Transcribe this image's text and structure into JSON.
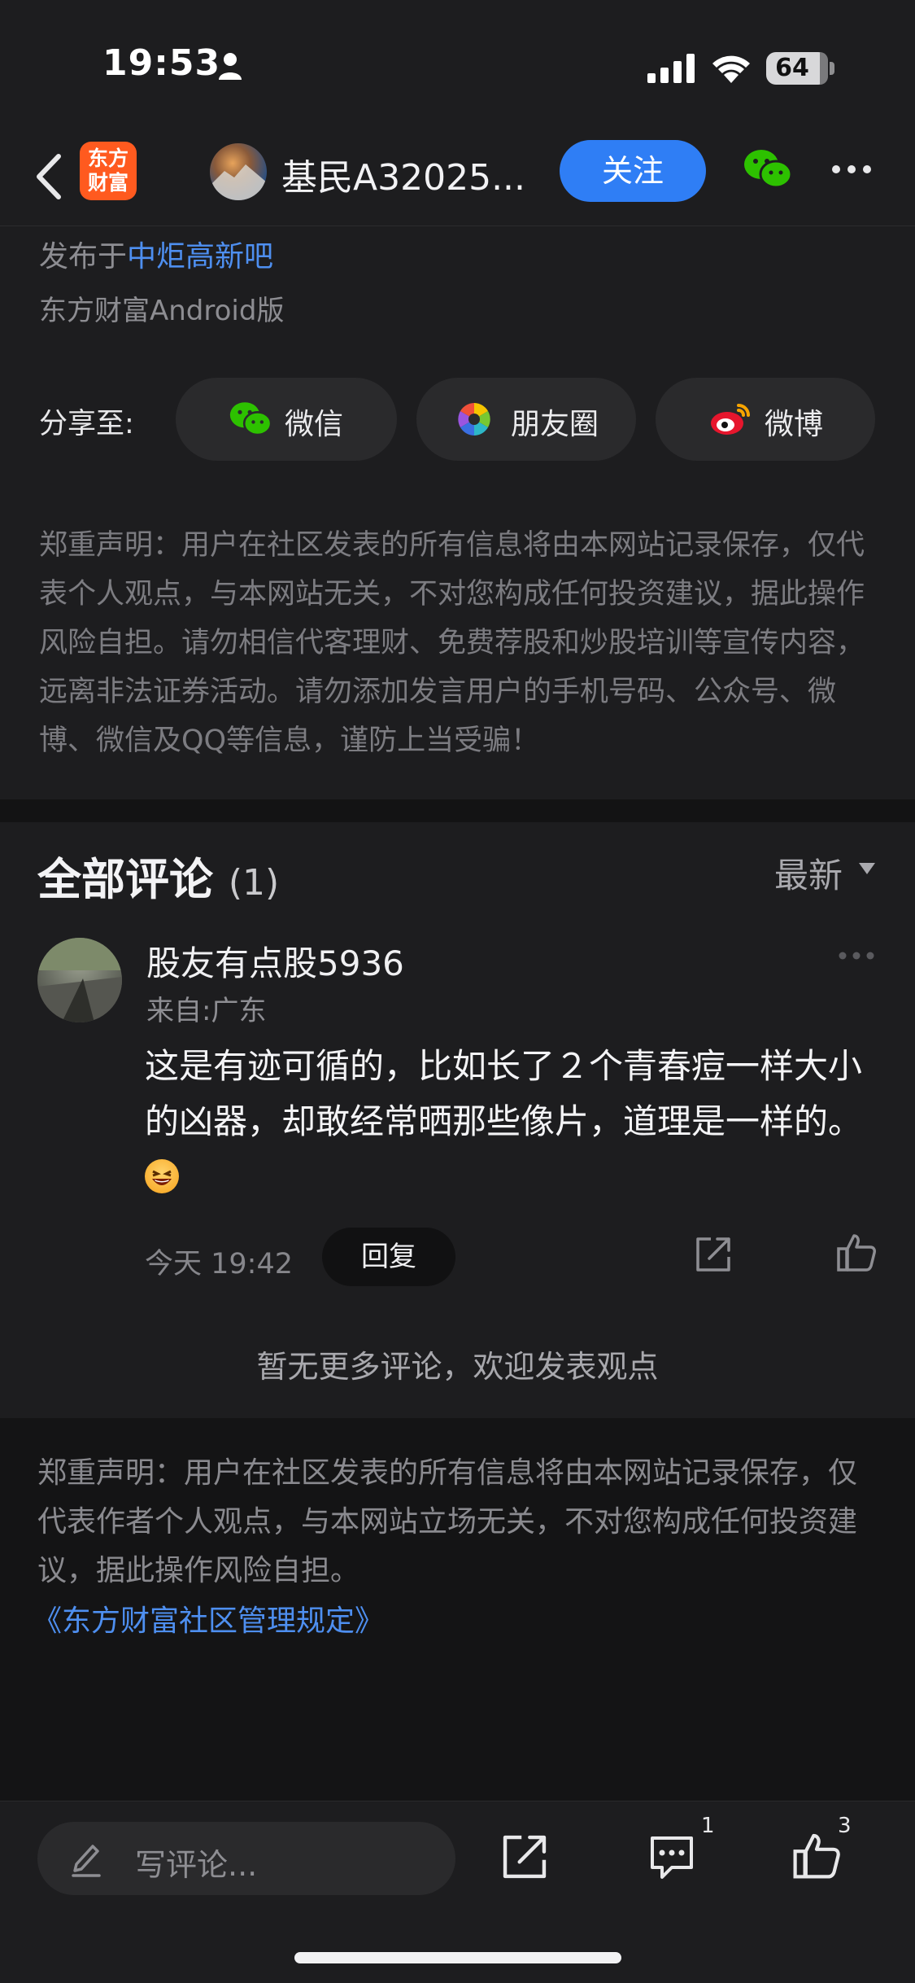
{
  "status_bar": {
    "time": "19:53",
    "battery": "64"
  },
  "nav": {
    "app_logo_text": "东方\n财富",
    "username": "基民A32025...",
    "follow_label": "关注"
  },
  "post_meta": {
    "published_prefix": "发布于",
    "published_board": "中炬高新吧",
    "platform": "东方财富Android版"
  },
  "share": {
    "label": "分享至:",
    "options": [
      {
        "label": "微信",
        "icon": "wechat-icon"
      },
      {
        "label": "朋友圈",
        "icon": "moments-icon"
      },
      {
        "label": "微博",
        "icon": "weibo-icon"
      }
    ]
  },
  "disclaimer_top": "郑重声明：用户在社区发表的所有信息将由本网站记录保存，仅代表个人观点，与本网站无关，不对您构成任何投资建议，据此操作风险自担。请勿相信代客理财、免费荐股和炒股培训等宣传内容，远离非法证券活动。请勿添加发言用户的手机号码、公众号、微博、微信及QQ等信息，谨防上当受骗！",
  "comments": {
    "title": "全部评论",
    "count": "(1)",
    "sort_label": "最新",
    "items": [
      {
        "author": "股友有点股5936",
        "location": "来自:广东",
        "text": "这是有迹可循的，比如长了２个青春痘一样大小的凶器，却敢经常晒那些像片，道理是一样的。",
        "time": "今天 19:42",
        "reply_label": "回复"
      }
    ],
    "no_more": "暂无更多评论，欢迎发表观点"
  },
  "footer": {
    "disclaimer": "郑重声明：用户在社区发表的所有信息将由本网站记录保存，仅代表作者个人观点，与本网站立场无关，不对您构成任何投资建议，据此操作风险自担。",
    "rules_link": "《东方财富社区管理规定》"
  },
  "bottom_bar": {
    "input_placeholder": "写评论...",
    "comment_count": "1",
    "like_count": "3"
  },
  "colors": {
    "background": "#1d1d1f",
    "accent_blue": "#2f7ef5",
    "link_blue": "#4e8ff0",
    "brand_orange": "#ff5a1f"
  }
}
